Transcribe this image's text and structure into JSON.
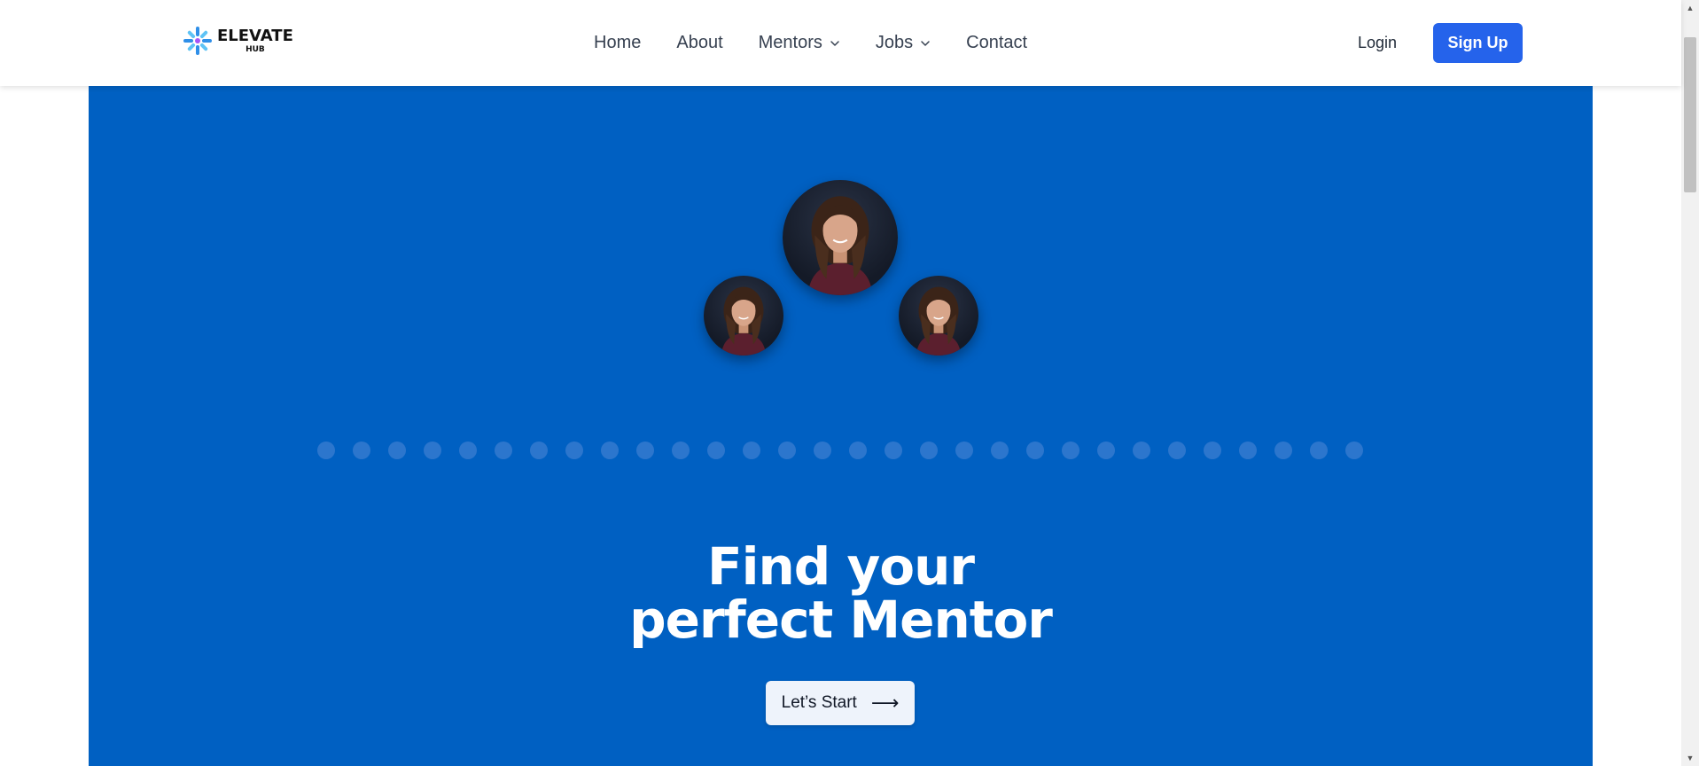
{
  "brand": {
    "title": "ELEVATE",
    "subtitle": "HUB"
  },
  "nav": {
    "items": [
      {
        "label": "Home",
        "has_dropdown": false
      },
      {
        "label": "About",
        "has_dropdown": false
      },
      {
        "label": "Mentors",
        "has_dropdown": true
      },
      {
        "label": "Jobs",
        "has_dropdown": true
      },
      {
        "label": "Contact",
        "has_dropdown": false
      }
    ],
    "login_label": "Login",
    "signup_label": "Sign Up"
  },
  "hero": {
    "headline_line1": "Find your",
    "headline_line2": "perfect Mentor",
    "cta_label": "Let’s Start",
    "cta_icon": "arrow-right-icon",
    "carousel_dot_count": 30
  },
  "colors": {
    "hero_bg": "#0060c2",
    "primary_button": "#2563eb",
    "dot": "#2c76cd"
  }
}
